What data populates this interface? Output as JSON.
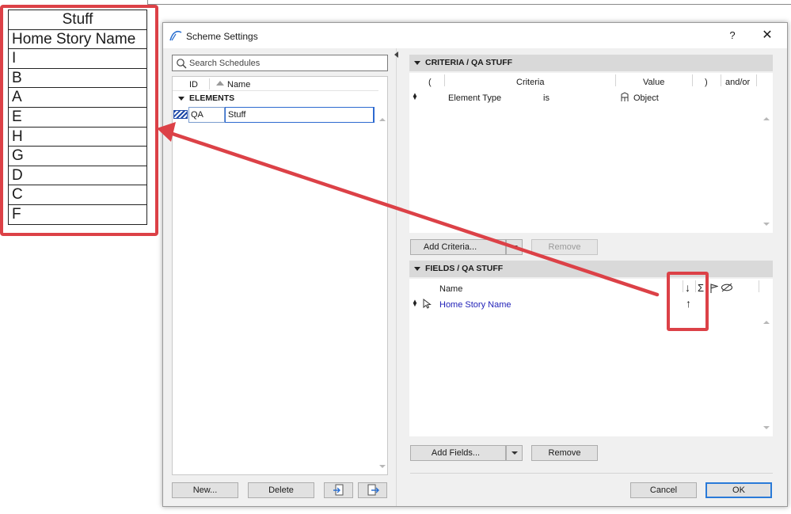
{
  "schedule_table": {
    "title": "Stuff",
    "header": "Home Story Name",
    "rows": [
      "I",
      "B",
      "A",
      "E",
      "H",
      "G",
      "D",
      "C",
      "F"
    ]
  },
  "dialog": {
    "title": "Scheme Settings",
    "help_label": "?",
    "close_label": "✕"
  },
  "left_pane": {
    "search_placeholder": "Search Schedules",
    "columns": {
      "id": "ID",
      "name": "Name"
    },
    "group_label": "ELEMENTS",
    "item": {
      "id": "QA",
      "name": "Stuff"
    },
    "buttons": {
      "new": "New...",
      "delete": "Delete"
    }
  },
  "criteria": {
    "section_title": "CRITERIA / QA STUFF",
    "columns": {
      "open_paren": "(",
      "criteria": "Criteria",
      "value": "Value",
      "close_paren": ")",
      "and_or": "and/or"
    },
    "row": {
      "criteria": "Element Type",
      "operator": "is",
      "value": "Object"
    },
    "buttons": {
      "add": "Add Criteria...",
      "remove": "Remove"
    }
  },
  "fields": {
    "section_title": "FIELDS / QA STUFF",
    "columns": {
      "name": "Name",
      "sort_desc": "↓",
      "sum": "Σ"
    },
    "row": {
      "name": "Home Story Name",
      "sort": "↑"
    },
    "buttons": {
      "add": "Add Fields...",
      "remove": "Remove"
    }
  },
  "footer": {
    "cancel": "Cancel",
    "ok": "OK"
  },
  "colors": {
    "highlight": "#dc4147",
    "accent_blue": "#2a7ad8",
    "field_link": "#2222b8"
  }
}
